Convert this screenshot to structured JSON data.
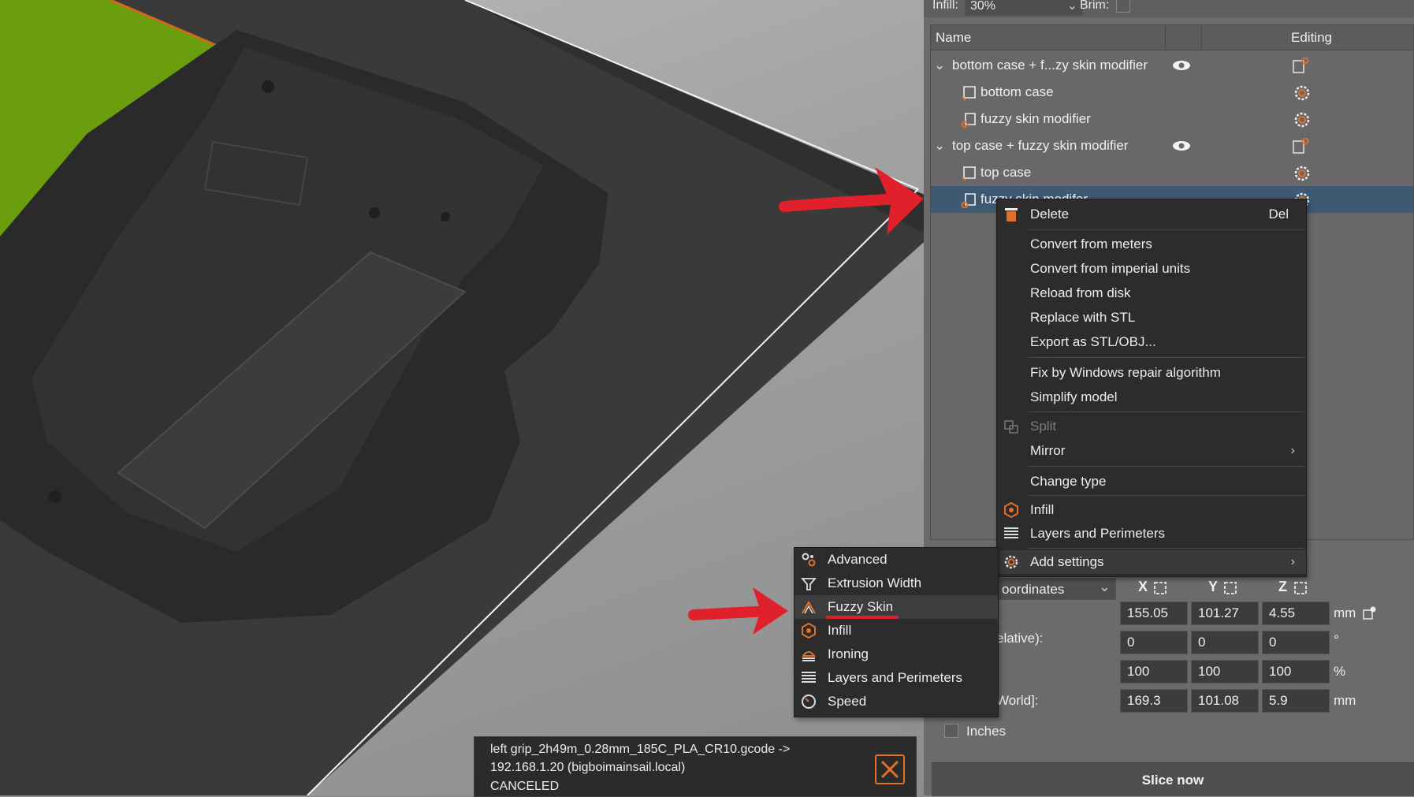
{
  "topbar": {
    "infill_label": "Infill:",
    "infill_value": "30%",
    "brim_label": "Brim:"
  },
  "tree": {
    "col_name": "Name",
    "col_editing": "Editing",
    "rows": [
      {
        "label": "bottom case + f...zy skin modifier"
      },
      {
        "label": "bottom case"
      },
      {
        "label": "fuzzy skin modifier"
      },
      {
        "label": "top case + fuzzy skin modifier"
      },
      {
        "label": "top case"
      },
      {
        "label": "fuzzy skin modifer"
      }
    ]
  },
  "context_menu": {
    "delete": "Delete",
    "delete_shortcut": "Del",
    "convert_meters": "Convert from meters",
    "convert_imperial": "Convert from imperial units",
    "reload": "Reload from disk",
    "replace_stl": "Replace with STL",
    "export": "Export as STL/OBJ...",
    "fix_windows": "Fix by Windows repair algorithm",
    "simplify": "Simplify model",
    "split": "Split",
    "mirror": "Mirror",
    "change_type": "Change type",
    "infill": "Infill",
    "layers": "Layers and Perimeters",
    "add_settings": "Add settings"
  },
  "submenu": {
    "advanced": "Advanced",
    "extrusion_width": "Extrusion Width",
    "fuzzy_skin": "Fuzzy Skin",
    "infill": "Infill",
    "ironing": "Ironing",
    "layers": "Layers and Perimeters",
    "speed": "Speed"
  },
  "coordinates": {
    "combo": "oordinates",
    "axis_x": "X",
    "axis_y": "Y",
    "axis_z": "Z",
    "rotation_label": "elative):",
    "size_label": "World]:",
    "position": [
      "155.05",
      "101.27",
      "4.55"
    ],
    "position_unit": "mm",
    "rotation": [
      "0",
      "0",
      "0"
    ],
    "rotation_unit": "°",
    "scale": [
      "100",
      "100",
      "100"
    ],
    "scale_unit": "%",
    "size": [
      "169.3",
      "101.08",
      "5.9"
    ],
    "size_unit": "mm",
    "inches_label": "Inches"
  },
  "slice_button": "Slice now",
  "notification": {
    "line1": "left grip_2h49m_0.28mm_185C_PLA_CR10.gcode ->",
    "line2": "192.168.1.20 (bigboimainsail.local)",
    "line3": "CANCELED"
  },
  "colors": {
    "accent": "#e2702a",
    "arrow": "#e0202a",
    "selection": "#3f5972",
    "green_plate": "#6a9e0e"
  }
}
